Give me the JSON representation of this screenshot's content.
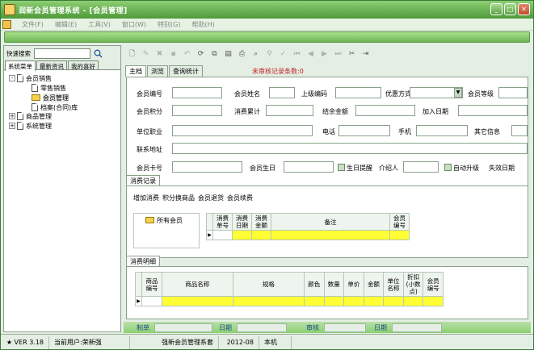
{
  "window": {
    "title": "润新会员管理系统 - [会员管理]",
    "controls": [
      "minimize-icon",
      "maximize-icon",
      "close-icon"
    ]
  },
  "menu": {
    "items": [
      "文件(F)",
      "编辑(E)",
      "工具(V)",
      "窗口(W)",
      "特别(G)",
      "帮助(H)"
    ]
  },
  "sidebar": {
    "search_label": "快速搜索",
    "tabs": [
      "系统菜单",
      "最新资讯",
      "我的喜好"
    ],
    "tree": [
      {
        "label": "会员销售",
        "expand": "-"
      },
      {
        "label": "零售销售"
      },
      {
        "label": "会员管理"
      },
      {
        "label": "档案(合同)库"
      },
      {
        "label": "商品管理",
        "expand": "+"
      },
      {
        "label": "系统管理",
        "expand": "+"
      }
    ]
  },
  "tabs": {
    "items": [
      "主档",
      "浏览",
      "查询统计"
    ],
    "unaudited": "未审核记录条数:0"
  },
  "form": {
    "member_no": "会员编号",
    "member_name": "会员姓名",
    "parent_no": "上级编码",
    "discount_type": "优惠方式",
    "member_level": "会员等级",
    "member_points": "会员积分",
    "consume_total": "消费累计",
    "balance": "结余金额",
    "join_date": "加入日期",
    "work_unit": "单位职业",
    "phone": "电话",
    "mobile": "手机",
    "other_info": "其它信息",
    "address": "联系地址",
    "card_no": "会员卡号",
    "birthday": "会员生日",
    "birthday_remind": "生日提醒",
    "referrer": "介绍人",
    "auto_upgrade": "自动升级",
    "expire": "失效日期"
  },
  "consume": {
    "tab": "消费记录",
    "actions": [
      "增加消费",
      "积分换商品",
      "会员退货",
      "会员续费"
    ],
    "all_members": "所有会员",
    "columns": [
      "消费单号",
      "消费日期",
      "消费金额",
      "备注",
      "会员编号"
    ]
  },
  "detail": {
    "tab": "消费明细",
    "columns": [
      "商品编号",
      "商品名称",
      "规格",
      "颜色",
      "数量",
      "单价",
      "金额",
      "单位名称",
      "折扣(小数点)",
      "会员编号"
    ]
  },
  "footer": {
    "made_by": "制单",
    "date1": "日期",
    "audit": "审核",
    "date2": "日期"
  },
  "status": {
    "version": "★ VER 3.18 ★",
    "user": "当前用户:荣新强",
    "company": "强新会员管理系套",
    "date": "2012-08",
    "host": "本机"
  }
}
